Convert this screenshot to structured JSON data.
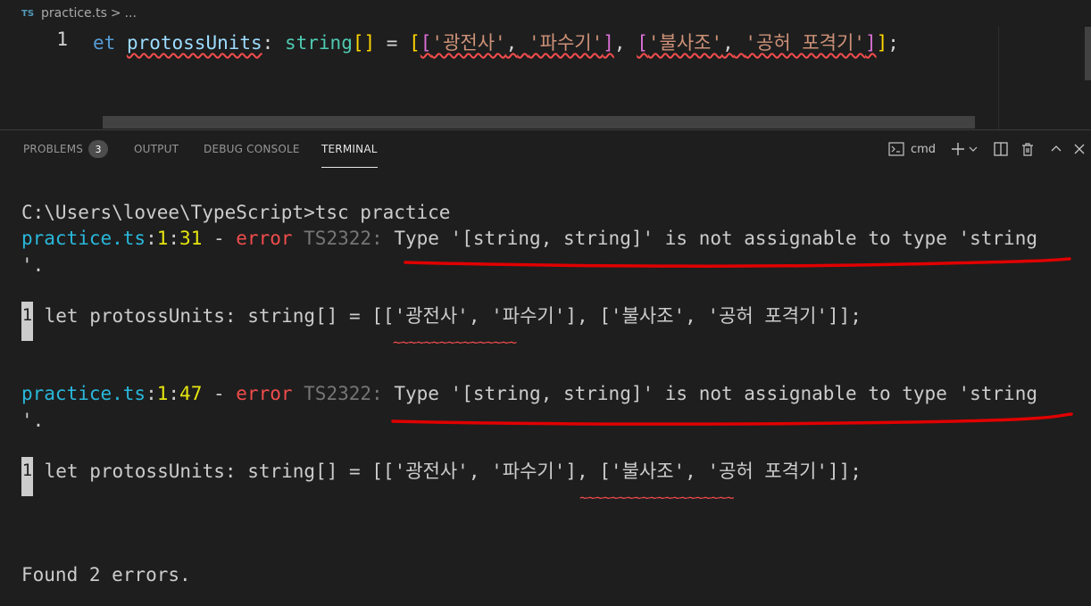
{
  "breadcrumb": {
    "lang_icon": "TS",
    "file": "practice.ts",
    "separator": ">",
    "more": "..."
  },
  "editor": {
    "line_number": "1",
    "tokens": {
      "kw": "et",
      "var": "protossUnits",
      "colon": ":",
      "type": "string",
      "arr": "[]",
      "eq": "=",
      "ob1": "[",
      "ob2": "[",
      "s1": "'광전사'",
      "comma1": ",",
      "s2": "'파수기'",
      "cb2": "]",
      "comma2": ",",
      "ob3": "[",
      "s3": "'불사조'",
      "comma3": ",",
      "s4": "'공허 포격기'",
      "cb3": "]",
      "cb1": "]",
      "semi": ";"
    }
  },
  "panel": {
    "tabs": [
      {
        "label": "PROBLEMS",
        "badge": "3"
      },
      {
        "label": "OUTPUT"
      },
      {
        "label": "DEBUG CONSOLE"
      },
      {
        "label": "TERMINAL"
      }
    ],
    "active_tab": "TERMINAL",
    "shell": "cmd"
  },
  "terminal": {
    "command": "C:\\Users\\lovee\\TypeScript>tsc practice",
    "errors": [
      {
        "file": "practice.ts",
        "line": "1",
        "col": "31",
        "sep": " - ",
        "level": "error",
        "code": "TS2322:",
        "message": "Type '[string, string]' is not assignable to type 'string",
        "wrap": "'.",
        "gutter": "1",
        "source": " let protossUnits: string[] = [['광전사', '파수기'], ['불사조', '공허 포격기']];",
        "tildes": "~~~~~~~~~~~~~~~~"
      },
      {
        "file": "practice.ts",
        "line": "1",
        "col": "47",
        "sep": " - ",
        "level": "error",
        "code": "TS2322:",
        "message": "Type '[string, string]' is not assignable to type 'string",
        "wrap": "'.",
        "gutter": "1",
        "source": " let protossUnits: string[] = [['광전사', '파수기'], ['불사조', '공허 포격기']];",
        "tildes": "~~~~~~~~~~~~~~~~~~~~"
      }
    ],
    "summary": "Found 2 errors."
  },
  "colors": {
    "annotation": "#e00000",
    "error": "#f14c4c",
    "filename": "#29b8db",
    "position": "#e5e510"
  }
}
